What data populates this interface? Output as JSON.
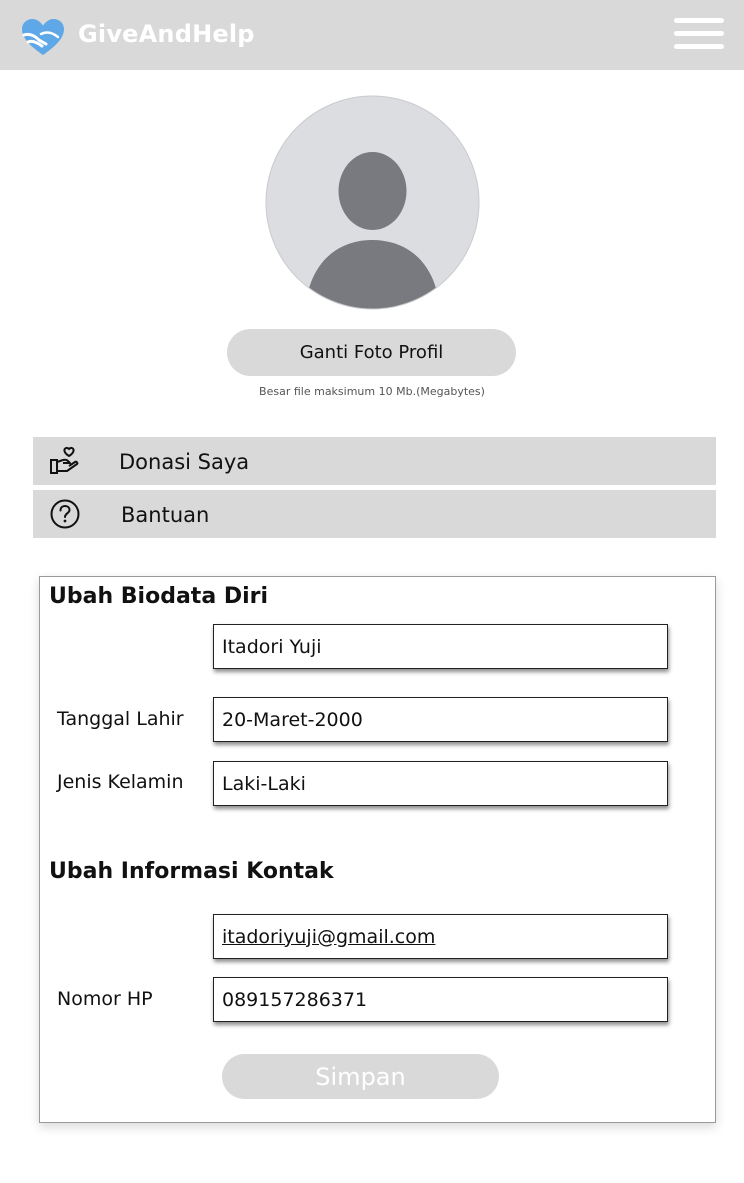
{
  "app": {
    "brand": "GiveAndHelp",
    "logo_icon": "heart-hands-icon",
    "menu_icon": "hamburger-menu-icon"
  },
  "profile": {
    "avatar_icon": "user-avatar-placeholder-icon",
    "change_photo_label": "Ganti Foto Profil",
    "file_note": "Besar file maksimum 10 Mb.(Megabytes)"
  },
  "nav": {
    "items": [
      {
        "label": "Donasi Saya",
        "icon": "donation-hand-heart-icon"
      },
      {
        "label": "Bantuan",
        "icon": "help-question-icon"
      }
    ]
  },
  "biodata": {
    "title": "Ubah Biodata Diri",
    "name_value": "Itadori Yuji",
    "birthdate_label": "Tanggal Lahir",
    "birthdate_value": "20-Maret-2000",
    "gender_label": "Jenis Kelamin",
    "gender_value": "Laki-Laki"
  },
  "contact": {
    "title": "Ubah Informasi Kontak",
    "email_value": "itadoriyuji@gmail.com",
    "phone_label": "Nomor HP",
    "phone_value": "089157286371"
  },
  "actions": {
    "save_label": "Simpan"
  },
  "colors": {
    "header_bg": "#d9d9d9",
    "logo_blue": "#5fa8e8",
    "button_bg": "#d9d9d9",
    "avatar_bg": "#dcdde1",
    "avatar_figure": "#787a80"
  }
}
